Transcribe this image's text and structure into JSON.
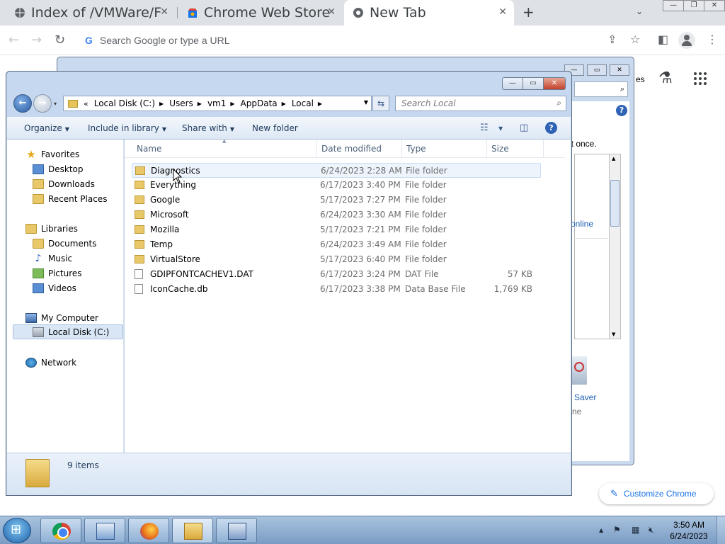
{
  "chrome": {
    "tabs": [
      {
        "label": "Index of /VMWare/F",
        "active": false
      },
      {
        "label": "Chrome Web Store",
        "active": false
      },
      {
        "label": "New Tab",
        "active": true
      }
    ],
    "new_tab": "+",
    "tab_search": "⌄",
    "omnibox_placeholder": "Search Google or type a URL",
    "customize_label": "Customize Chrome"
  },
  "background_dialog": {
    "texts": [
      "es",
      "it once.",
      "online",
      "Saver",
      "ne"
    ]
  },
  "explorer": {
    "breadcrumbs": [
      "Local Disk (C:)",
      "Users",
      "vm1",
      "AppData",
      "Local"
    ],
    "breadcrumb_prefix": "«",
    "search_placeholder": "Search Local",
    "commands": {
      "organize": "Organize",
      "include_library": "Include in library",
      "share_with": "Share with",
      "new_folder": "New folder"
    },
    "sidebar": {
      "favorites": "Favorites",
      "desktop": "Desktop",
      "downloads": "Downloads",
      "recent_places": "Recent Places",
      "libraries": "Libraries",
      "documents": "Documents",
      "music": "Music",
      "pictures": "Pictures",
      "videos": "Videos",
      "my_computer": "My Computer",
      "local_disk": "Local Disk (C:)",
      "network": "Network"
    },
    "columns": {
      "name": "Name",
      "date": "Date modified",
      "type": "Type",
      "size": "Size"
    },
    "files": [
      {
        "name": "Diagnostics",
        "date": "6/24/2023 2:28 AM",
        "type": "File folder",
        "size": "",
        "kind": "folder"
      },
      {
        "name": "Everything",
        "date": "6/17/2023 3:40 PM",
        "type": "File folder",
        "size": "",
        "kind": "folder"
      },
      {
        "name": "Google",
        "date": "5/17/2023 7:27 PM",
        "type": "File folder",
        "size": "",
        "kind": "folder"
      },
      {
        "name": "Microsoft",
        "date": "6/24/2023 3:30 AM",
        "type": "File folder",
        "size": "",
        "kind": "folder"
      },
      {
        "name": "Mozilla",
        "date": "5/17/2023 7:21 PM",
        "type": "File folder",
        "size": "",
        "kind": "folder"
      },
      {
        "name": "Temp",
        "date": "6/24/2023 3:49 AM",
        "type": "File folder",
        "size": "",
        "kind": "folder"
      },
      {
        "name": "VirtualStore",
        "date": "5/17/2023 6:40 PM",
        "type": "File folder",
        "size": "",
        "kind": "folder"
      },
      {
        "name": "GDIPFONTCACHEV1.DAT",
        "date": "6/17/2023 3:24 PM",
        "type": "DAT File",
        "size": "57 KB",
        "kind": "file"
      },
      {
        "name": "IconCache.db",
        "date": "6/17/2023 3:38 PM",
        "type": "Data Base File",
        "size": "1,769 KB",
        "kind": "file"
      }
    ],
    "item_count": "9 items"
  },
  "taskbar": {
    "time": "3:50 AM",
    "date": "6/24/2023"
  }
}
